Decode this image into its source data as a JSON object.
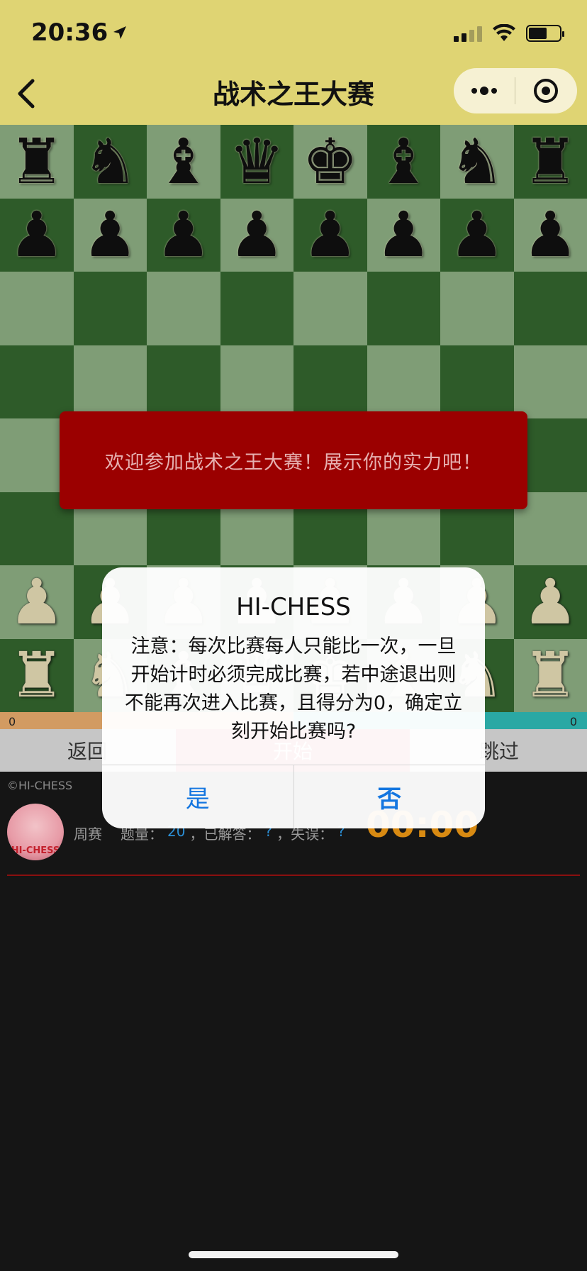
{
  "status_bar": {
    "time": "20:36"
  },
  "nav": {
    "title": "战术之王大赛"
  },
  "board": {
    "rows": [
      [
        "♜",
        "♞",
        "♝",
        "♛",
        "♚",
        "♝",
        "♞",
        "♜"
      ],
      [
        "♟",
        "♟",
        "♟",
        "♟",
        "♟",
        "♟",
        "♟",
        "♟"
      ],
      [
        "",
        "",
        "",
        "",
        "",
        "",
        "",
        ""
      ],
      [
        "",
        "",
        "",
        "",
        "",
        "",
        "",
        ""
      ],
      [
        "",
        "",
        "",
        "",
        "",
        "",
        "",
        ""
      ],
      [
        "",
        "",
        "",
        "",
        "",
        "",
        "",
        ""
      ],
      [
        "♟",
        "♟",
        "♟",
        "♟",
        "♟",
        "♟",
        "♟",
        "♟"
      ],
      [
        "♜",
        "♞",
        "♝",
        "♛",
        "♚",
        "♝",
        "♞",
        "♜"
      ]
    ],
    "colors": [
      "b",
      "b",
      "",
      "",
      "",
      "",
      "w",
      "w"
    ]
  },
  "banner": {
    "text": "欢迎参加战术之王大赛！展示你的实力吧！"
  },
  "scorebar": {
    "left": "0",
    "right": "0"
  },
  "controls": {
    "back_label": "返回",
    "start_label": "开始",
    "skip_label": "跳过"
  },
  "info": {
    "copyright": "©HI-CHESS",
    "avatar_text": "HI-CHESS",
    "mode": "周赛",
    "count_label": "题量：",
    "count": "20",
    "solved_label": "，已解答：",
    "solved": "?",
    "mistakes_label": "，失误：",
    "mistakes": "?",
    "timer": "00:00"
  },
  "modal": {
    "title": "HI-CHESS",
    "body": "注意：每次比赛每人只能比一次，一旦开始计时必须完成比赛，若中途退出则不能再次进入比赛，且得分为0，确定立刻开始比赛吗?",
    "yes_label": "是",
    "no_label": "否"
  }
}
